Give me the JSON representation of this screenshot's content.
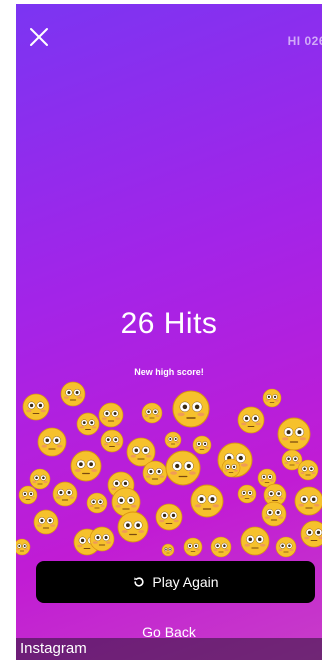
{
  "header": {
    "hi_score": "HI 026"
  },
  "result": {
    "hits": "26 Hits",
    "subtitle": "New high score!"
  },
  "actions": {
    "play_again": "Play Again",
    "go_back": "Go Back"
  },
  "footer": {
    "app_name": "Instagram"
  },
  "icons": {
    "close": "close-icon",
    "replay": "replay-icon",
    "emoji": "flushed-face-emoji"
  },
  "colors": {
    "gradient_start": "#7b35f2",
    "gradient_end": "#c83dc8",
    "button_bg": "#000000",
    "emoji_face": "#f6c12c"
  }
}
